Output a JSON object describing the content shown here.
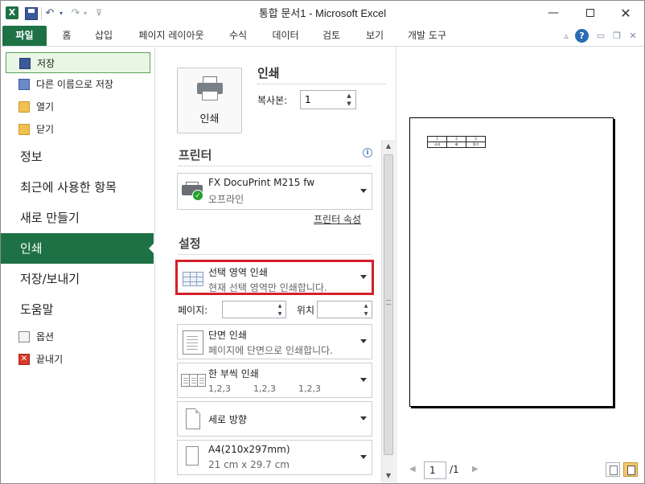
{
  "window": {
    "title": "통합 문서1 - Microsoft Excel",
    "app_icon": "X",
    "controls": {
      "minimize": "—",
      "close": "✕"
    }
  },
  "qat": {
    "undo_icon": "↶",
    "redo_icon": "↷",
    "dropdown_icon": "▾",
    "customize_icon": "⊽"
  },
  "tabs": {
    "file": "파일",
    "home": "홈",
    "insert": "삽입",
    "page_layout": "페이지 레이아웃",
    "formulas": "수식",
    "data": "데이터",
    "review": "검토",
    "view": "보기",
    "developer": "개발 도구",
    "help_icon": "?",
    "collapse_icon": "▵",
    "min_icon": "▭",
    "restore_icon": "❐",
    "close_icon": "✕"
  },
  "nav": {
    "save": "저장",
    "save_as": "다른 이름으로 저장",
    "open": "열기",
    "close": "닫기",
    "info": "정보",
    "recent": "최근에 사용한 항목",
    "new": "새로 만들기",
    "print": "인쇄",
    "save_send": "저장/보내기",
    "help": "도움말",
    "options": "옵션",
    "exit": "끝내기",
    "exit_icon": "✕"
  },
  "print": {
    "button_label": "인쇄",
    "heading": "인쇄",
    "copies_label": "복사본:",
    "copies_value": "1",
    "spin_up": "▲",
    "spin_down": "▼"
  },
  "printer": {
    "heading": "프린터",
    "info_icon": "i",
    "name": "FX DocuPrint M215 fw",
    "status": "오프라인",
    "ok_icon": "✓",
    "properties_link": "프린터 속성"
  },
  "settings": {
    "heading": "설정",
    "scope": {
      "main": "선택 영역 인쇄",
      "sub": "현재 선택 영역만 인쇄합니다."
    },
    "pages_label": "페이지:",
    "to_label": "위치",
    "pages_from": "",
    "pages_to": "",
    "sides": {
      "main": "단면 인쇄",
      "sub": "페이지에 단면으로 인쇄합니다."
    },
    "collate": {
      "main": "한 부씩 인쇄",
      "seq": [
        "1,2,3",
        "1,2,3",
        "1,2,3"
      ]
    },
    "orientation": {
      "main": "세로 방향"
    },
    "paper": {
      "main": "A4(210x297mm)",
      "sub": "21 cm x 29.7 cm"
    }
  },
  "scrollbar": {
    "up": "▲",
    "down": "▼"
  },
  "preview": {
    "table_row1": [
      "1",
      "2",
      "3"
    ],
    "table_row2": [
      "사과",
      "배",
      "딸기"
    ],
    "page_current": "1",
    "page_total": "/1",
    "prev_icon": "◀",
    "next_icon": "▶"
  },
  "colors": {
    "accent": "#1e7145",
    "highlight_border": "#d4202a"
  }
}
